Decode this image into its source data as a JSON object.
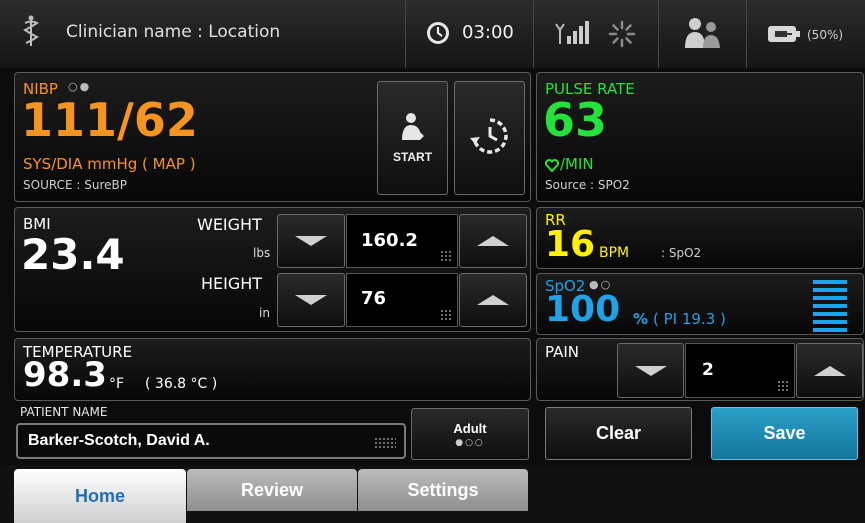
{
  "status_bar": {
    "clinician_location": "Clinician name : Location",
    "time": "03:00",
    "battery": "(50%)"
  },
  "nibp": {
    "label": "NIBP",
    "value": "111/62",
    "units": "SYS/DIA mmHg ( MAP )",
    "source": "SOURCE : SureBP",
    "start_label": "START",
    "color": "#f7941d"
  },
  "pulse": {
    "label": "PULSE RATE",
    "value": "63",
    "units": "/MIN",
    "source": "Source : SPO2",
    "color": "#22e33a"
  },
  "bmi": {
    "label": "BMI",
    "value": "23.4",
    "weight_label": "WEIGHT",
    "weight_unit": "lbs",
    "weight_value": "160.2",
    "height_label": "HEIGHT",
    "height_unit": "in",
    "height_value": "76"
  },
  "rr": {
    "label": "RR",
    "value": "16",
    "units": "BPM",
    "source": ": SpO2",
    "color": "#fff200"
  },
  "spo2": {
    "label": "SpO2",
    "value": "100",
    "units": "%",
    "pi": "( PI 19.3 )",
    "color": "#1fa3e8"
  },
  "temperature": {
    "label": "TEMPERATURE",
    "value": "98.3",
    "unit": "°F",
    "celsius": "( 36.8 °C )"
  },
  "pain": {
    "label": "PAIN",
    "value": "2"
  },
  "patient": {
    "label": "PATIENT NAME",
    "name": "Barker-Scotch, David A.",
    "type": "Adult"
  },
  "actions": {
    "clear": "Clear",
    "save": "Save"
  },
  "tabs": [
    "Home",
    "Review",
    "Settings"
  ]
}
